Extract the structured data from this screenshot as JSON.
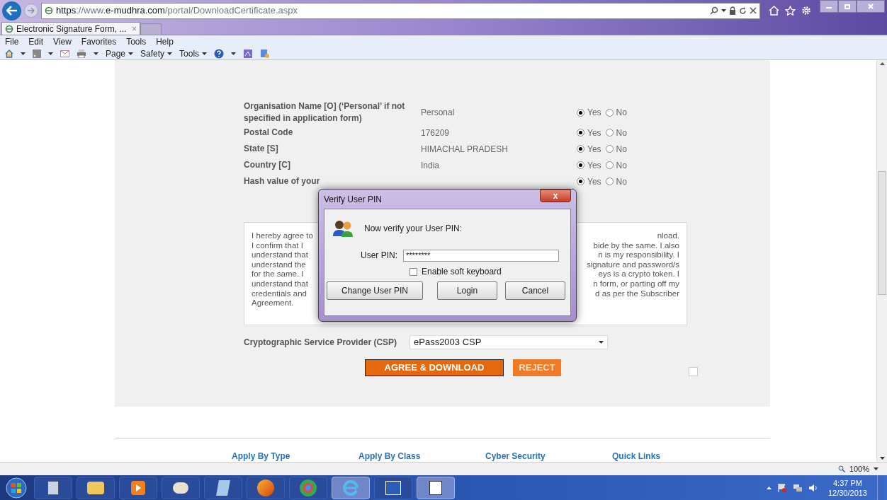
{
  "browser": {
    "url_prefix": "https://www.",
    "url_domain": "e-mudhra.com",
    "url_path": "/portal/DownloadCertificate.aspx",
    "tab_title": "Electronic Signature Form, ...",
    "tab_close": "×",
    "menu": [
      "File",
      "Edit",
      "View",
      "Favorites",
      "Tools",
      "Help"
    ],
    "commands": [
      "Page",
      "Safety",
      "Tools"
    ],
    "zoom": "100%"
  },
  "form": {
    "rows": [
      {
        "label": "Organisation Name [O] (‘Personal’ if not specified in application form)",
        "value": "Personal",
        "options": [
          {
            "label": "Yes",
            "selected": true
          },
          {
            "label": "No",
            "selected": false
          }
        ]
      },
      {
        "label": "Postal Code",
        "value": "176209",
        "options": [
          {
            "label": "Yes",
            "selected": true
          },
          {
            "label": "No",
            "selected": false
          }
        ]
      },
      {
        "label": "State [S]",
        "value": "HIMACHAL PRADESH",
        "options": [
          {
            "label": "Yes",
            "selected": true
          },
          {
            "label": "No",
            "selected": false
          }
        ]
      },
      {
        "label": "Country [C]",
        "value": "India",
        "options": [
          {
            "label": "Yes",
            "selected": true
          },
          {
            "label": "No",
            "selected": false
          }
        ]
      },
      {
        "label": "Hash value of your",
        "value": "",
        "options": [
          {
            "label": "Yes",
            "selected": true
          },
          {
            "label": "No",
            "selected": false
          }
        ]
      }
    ],
    "agreement_lines": [
      {
        "left": "I hereby agree to",
        "right": "nload."
      },
      {
        "left": "I confirm that I",
        "right": "bide by the same. I also"
      },
      {
        "left": "understand that",
        "right": "n is my responsibility. I"
      },
      {
        "left": "understand the",
        "right": "signature and password/s"
      },
      {
        "left": "for the same. I",
        "right": "eys is a crypto token. I"
      },
      {
        "left": "understand that",
        "right": "n form, or parting off my"
      },
      {
        "left": "credentials and",
        "right": "d as per the Subscriber"
      },
      {
        "left": "Agreement."
      }
    ],
    "csp_label": "Cryptographic Service Provider (CSP)",
    "csp_value": "ePass2003 CSP",
    "agree_button": "AGREE & DOWNLOAD",
    "reject_button": "REJECT",
    "confirm_checked": false
  },
  "footer_links": [
    "Apply By Type",
    "Apply By Class",
    "Cyber Security",
    "Quick Links"
  ],
  "dialog": {
    "title": "Verify User PIN",
    "close": "x",
    "message": "Now verify your User PIN:",
    "pin_label": "User PIN:",
    "pin_value": "********",
    "soft_keyboard": {
      "label": "Enable soft keyboard",
      "checked": false
    },
    "buttons": [
      "Change User PIN",
      "Login",
      "Cancel"
    ]
  },
  "taskbar": {
    "time": "4:37 PM",
    "date": "12/30/2013"
  }
}
